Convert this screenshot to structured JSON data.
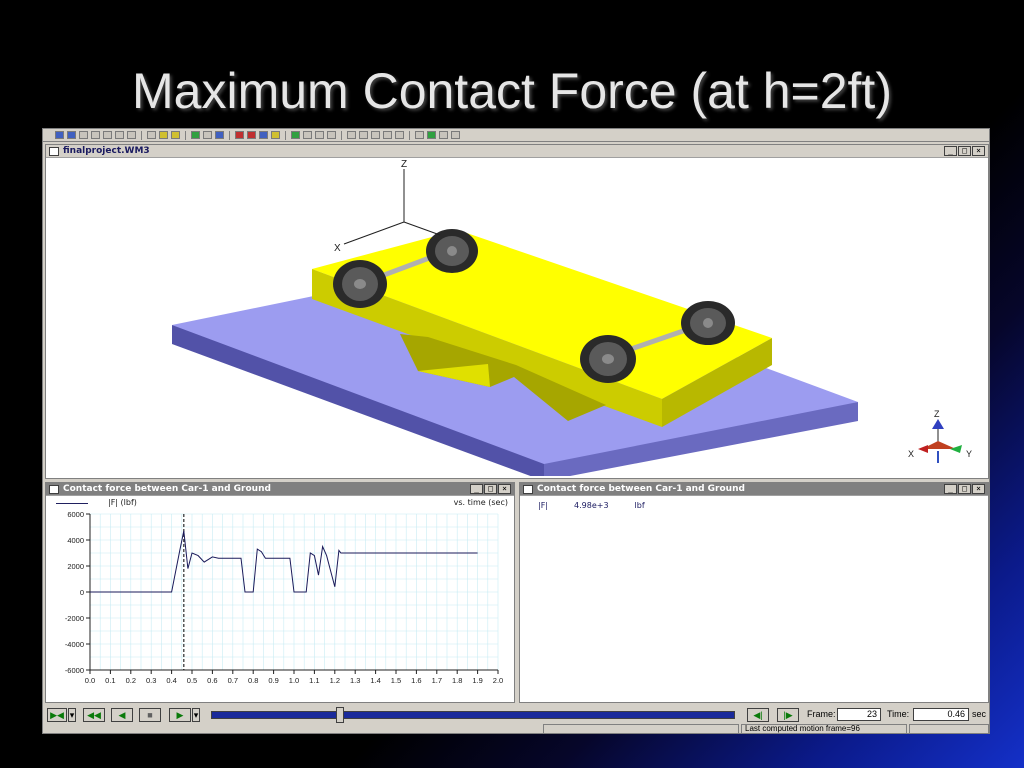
{
  "slide": {
    "title": "Maximum Contact Force (at h=2ft)"
  },
  "main_window": {
    "title": "finalproject.WM3",
    "axis_labels": {
      "z": "Z",
      "x": "X"
    },
    "triad_labels": {
      "z": "Z",
      "x": "X",
      "y": "Y"
    }
  },
  "window_buttons": {
    "minimize": "_",
    "restore": "□",
    "close": "×"
  },
  "plot_window": {
    "title": "Contact force between Car-1 and Ground",
    "legend_label": "|F| (lbf)",
    "legend_right": "vs. time (sec)"
  },
  "meter_window": {
    "title": "Contact force between Car-1 and Ground",
    "name": "|F|",
    "value": "4.98e+3",
    "unit": "lbf"
  },
  "chart_data": {
    "type": "line",
    "title": "",
    "xlabel": "",
    "ylabel": "",
    "xlim": [
      0,
      2.0
    ],
    "ylim": [
      -6000,
      6000
    ],
    "xticks": [
      "0.0",
      "0.1",
      "0.2",
      "0.3",
      "0.4",
      "0.5",
      "0.6",
      "0.7",
      "0.8",
      "0.9",
      "1.0",
      "1.1",
      "1.2",
      "1.3",
      "1.4",
      "1.5",
      "1.6",
      "1.7",
      "1.8",
      "1.9",
      "2.0"
    ],
    "yticks": [
      "6000",
      "4000",
      "2000",
      "0",
      "-2000",
      "-4000",
      "-6000"
    ],
    "grid": true,
    "marker_time": 0.46,
    "series": [
      {
        "name": "|F| (lbf)",
        "x": [
          0.0,
          0.4,
          0.44,
          0.46,
          0.48,
          0.5,
          0.53,
          0.56,
          0.6,
          0.63,
          0.74,
          0.76,
          0.8,
          0.82,
          0.84,
          0.86,
          0.88,
          0.92,
          0.98,
          1.0,
          1.06,
          1.08,
          1.1,
          1.12,
          1.14,
          1.16,
          1.18,
          1.2,
          1.22,
          1.23,
          1.3,
          1.6,
          1.9
        ],
        "y": [
          0,
          0,
          3200,
          4700,
          1800,
          3000,
          2800,
          2300,
          2700,
          2600,
          2600,
          0,
          0,
          3300,
          3100,
          2600,
          2600,
          2600,
          2600,
          0,
          0,
          3000,
          2800,
          1300,
          3500,
          2800,
          1600,
          400,
          3200,
          3000,
          3000,
          3000,
          3000
        ]
      }
    ]
  },
  "controls": {
    "frame_label": "Frame:",
    "frame_value": "23",
    "time_label": "Time:",
    "time_value": "0.46",
    "time_unit": "sec",
    "status_text": "Last computed motion frame=96",
    "slider_fraction": 0.24
  }
}
